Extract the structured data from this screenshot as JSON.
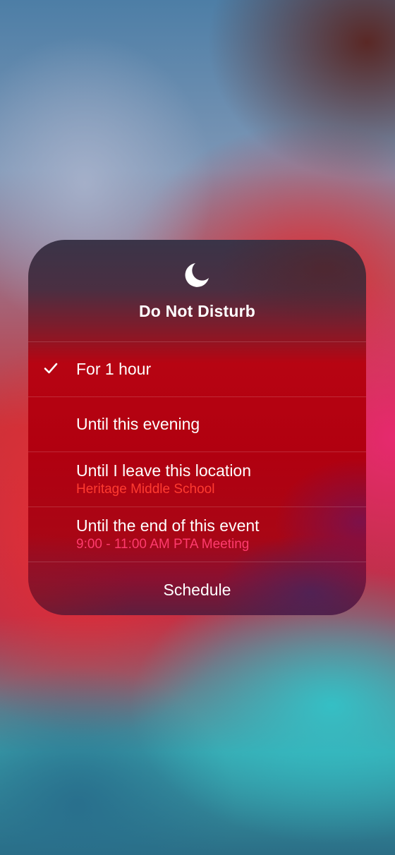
{
  "panel": {
    "title": "Do Not Disturb",
    "icon": "moon-icon"
  },
  "options": [
    {
      "label": "For 1 hour",
      "selected": true,
      "icon": "checkmark-icon"
    },
    {
      "label": "Until this evening",
      "selected": false
    },
    {
      "label": "Until I leave this location",
      "subtitle": "Heritage Middle School",
      "selected": false
    },
    {
      "label": "Until the end of this event",
      "subtitle": "9:00 - 11:00 AM PTA Meeting",
      "selected": false
    }
  ],
  "schedule_label": "Schedule",
  "colors": {
    "subtitle_location": "#ff3b30",
    "subtitle_event": "#ff3b6e",
    "text": "#ffffff"
  }
}
